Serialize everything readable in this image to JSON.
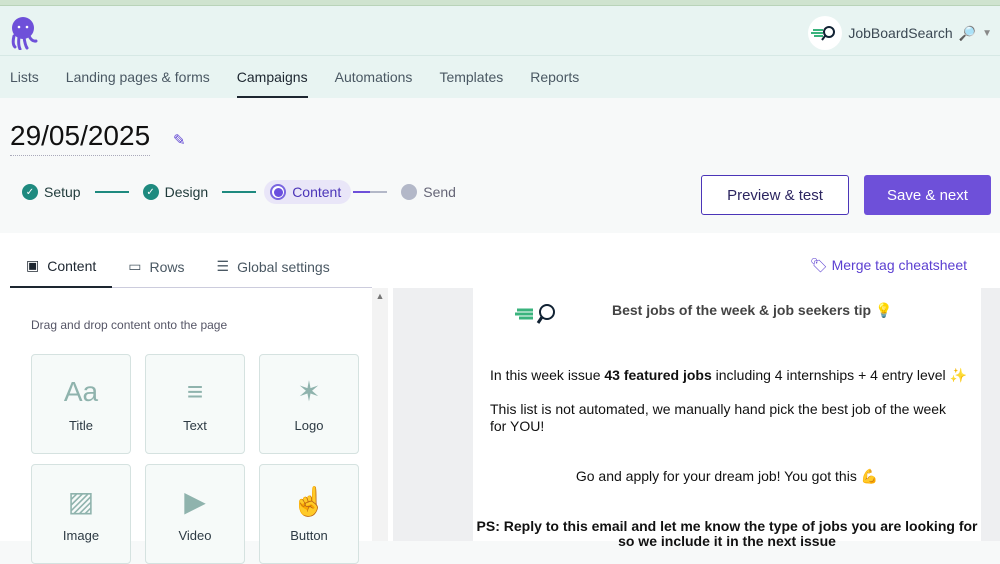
{
  "account": {
    "name": "JobBoardSearch",
    "emoji": "🔎"
  },
  "nav": [
    "Lists",
    "Landing pages & forms",
    "Campaigns",
    "Automations",
    "Templates",
    "Reports"
  ],
  "campaign_title": "29/05/2025",
  "steps": [
    "Setup",
    "Design",
    "Content",
    "Send"
  ],
  "buttons": {
    "preview": "Preview & test",
    "save": "Save & next"
  },
  "tabs": [
    "Content",
    "Rows",
    "Global settings"
  ],
  "merge_link": "Merge tag cheatsheet",
  "hint": "Drag and drop content onto the page",
  "blocks": [
    "Title",
    "Text",
    "Logo",
    "Image",
    "Video",
    "Button"
  ],
  "email": {
    "heading": "Best jobs of the week & job seekers tip 💡",
    "p1_pre": "In this week issue ",
    "p1_bold": "43 featured jobs",
    "p1_post": " including 4 internships + 4 entry level  ✨",
    "p2": "This list is not automated, we manually hand pick the best job of the week for YOU!",
    "p3": "Go and apply for your dream job! You got this 💪",
    "p4": "PS: Reply to this email and let me know the type of jobs you are looking for so we include it in the next issue"
  },
  "colors": {
    "accent": "#6e50d9",
    "teal": "#1e8a7f"
  }
}
